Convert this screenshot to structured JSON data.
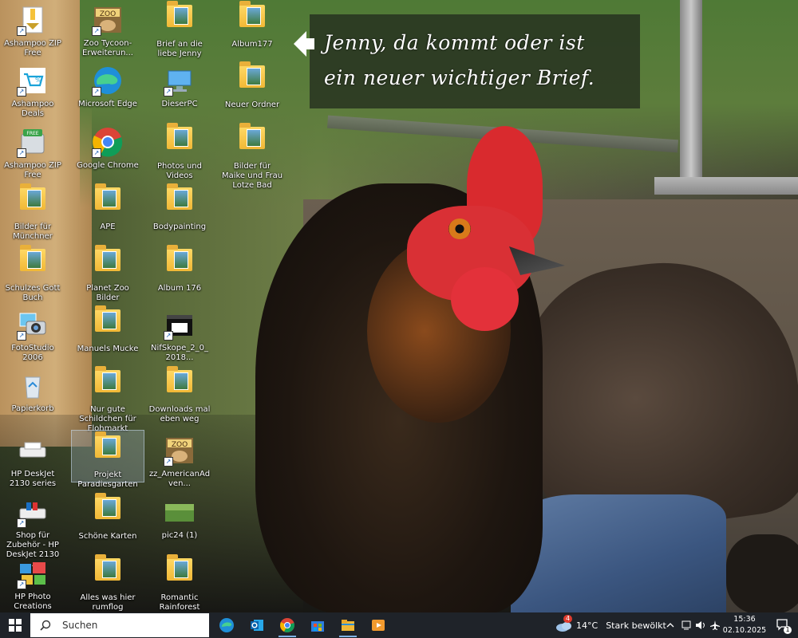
{
  "note": {
    "line1": "Jenny, da kommt oder ist",
    "line2": "ein neuer wichtiger Brief."
  },
  "icons": [
    {
      "label": "Ashampoo ZIP Free",
      "icon": "zip-archive-icon"
    },
    {
      "label": "Ashampoo Deals",
      "icon": "deals-cart-icon"
    },
    {
      "label": "Ashampoo ZIP Free",
      "icon": "zip-free-icon"
    },
    {
      "label": "Bilder für Münchner",
      "icon": "folder-icon"
    },
    {
      "label": "Schulzes Gott Buch",
      "icon": "folder-icon"
    },
    {
      "label": "FotoStudio 2006",
      "icon": "camera-app-icon"
    },
    {
      "label": "Papierkorb",
      "icon": "recycle-bin-icon"
    },
    {
      "label": "HP DeskJet 2130 series",
      "icon": "printer-icon"
    },
    {
      "label": "Shop für Zubehör - HP DeskJet 2130 ...",
      "icon": "printer-shop-icon"
    },
    {
      "label": "HP Photo Creations",
      "icon": "hp-photo-creations-icon"
    },
    {
      "label": "Zoo Tycoon-Erweiterun...",
      "icon": "zoo-tycoon-icon"
    },
    {
      "label": "Microsoft Edge",
      "icon": "edge-icon"
    },
    {
      "label": "Google Chrome",
      "icon": "chrome-icon"
    },
    {
      "label": "APE",
      "icon": "folder-icon"
    },
    {
      "label": "Planet Zoo Bilder",
      "icon": "folder-icon"
    },
    {
      "label": "Manuels Mucke",
      "icon": "folder-icon"
    },
    {
      "label": "Nur gute Schildchen für Flohmarkt",
      "icon": "folder-icon"
    },
    {
      "label": "Projekt Paradiesgarten",
      "icon": "folder-icon"
    },
    {
      "label": "Schöne Karten",
      "icon": "folder-icon"
    },
    {
      "label": "Alles was hier rumflog",
      "icon": "folder-icon"
    },
    {
      "label": "Brief an die liebe Jenny",
      "icon": "folder-icon"
    },
    {
      "label": "DieserPC",
      "icon": "this-pc-icon"
    },
    {
      "label": "Photos und Videos",
      "icon": "folder-icon"
    },
    {
      "label": "Bodypainting",
      "icon": "folder-icon"
    },
    {
      "label": "Album 176",
      "icon": "folder-icon"
    },
    {
      "label": "NifSkope_2_0_2018...",
      "icon": "nifskope-icon"
    },
    {
      "label": "Downloads mal eben weg",
      "icon": "folder-icon"
    },
    {
      "label": "zz_AmericanAdven...",
      "icon": "zoo-tycoon-icon"
    },
    {
      "label": "pic24 (1)",
      "icon": "image-thumbnail-icon"
    },
    {
      "label": "Romantic Rainforest",
      "icon": "folder-icon"
    },
    {
      "label": "Album177",
      "icon": "folder-icon"
    },
    {
      "label": "Neuer Ordner",
      "icon": "folder-icon"
    },
    {
      "label": "Bilder für Maike und Frau Lotze Bad",
      "icon": "folder-icon"
    }
  ],
  "selected_icon": "Projekt Paradiesgarten",
  "taskbar": {
    "search_placeholder": "Suchen",
    "apps": [
      "edge-icon",
      "outlook-icon",
      "chrome-icon",
      "store-icon",
      "file-explorer-icon",
      "media-player-icon"
    ],
    "weather_temp": "14°C",
    "weather_desc": "Stark bewölkt",
    "weather_badge": "4",
    "time": "15:36",
    "date": "02.10.2025",
    "notification_count": "1"
  },
  "colors": {
    "taskbar_bg": "#1f2329",
    "selection": "#b4c8dc",
    "folder": "#f1b836",
    "note_bg": "#1e261c"
  }
}
